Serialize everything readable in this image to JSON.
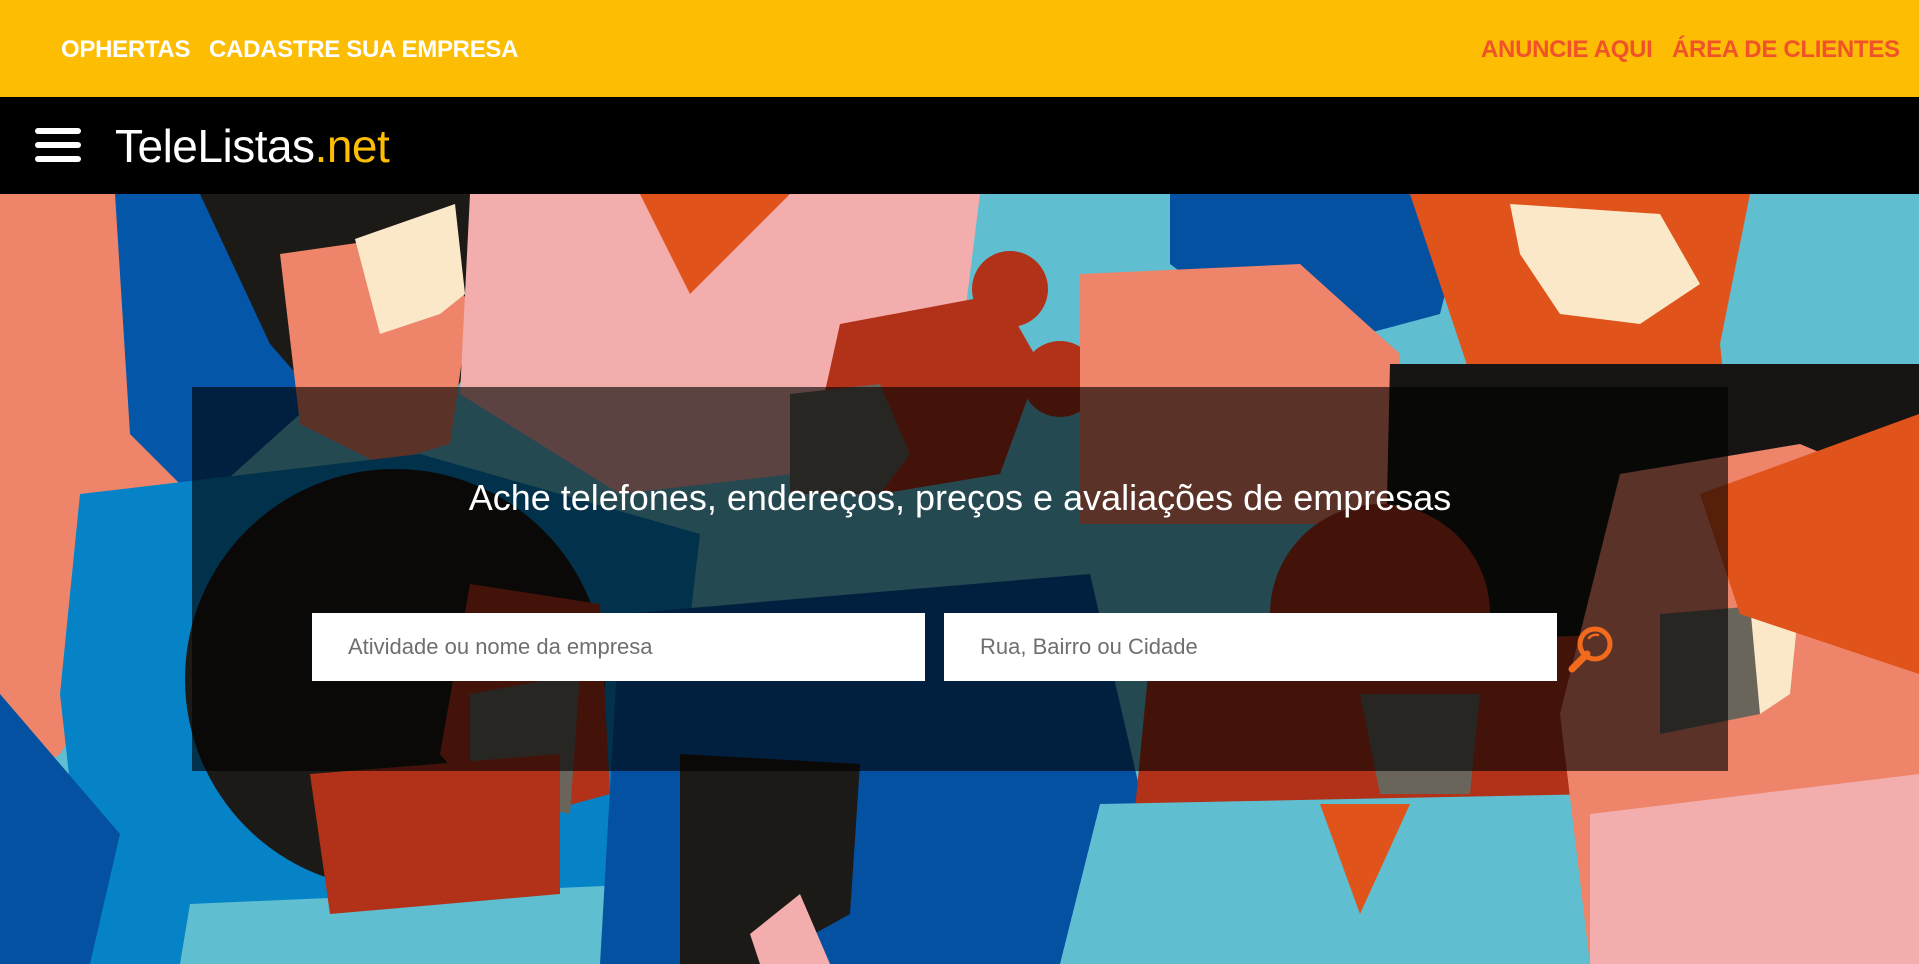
{
  "topbar": {
    "left_links": [
      {
        "label": "OPHERTAS"
      },
      {
        "label": "CADASTRE SUA EMPRESA"
      }
    ],
    "right_links": [
      {
        "label": "ANUNCIE AQUI"
      },
      {
        "label": "ÁREA DE CLIENTES"
      }
    ],
    "background": "#fdbd03",
    "left_link_color": "#ffffff",
    "right_link_color": "#f0532a"
  },
  "header": {
    "menu_icon": "hamburger-menu-icon",
    "logo_main": "TeleListas",
    "logo_tld": ".net",
    "logo_tld_color": "#fdbd03"
  },
  "hero": {
    "headline": "Ache telefones, endereços, preços e avaliações de empresas",
    "activity_placeholder": "Atividade ou nome da empresa",
    "activity_value": "",
    "location_placeholder": "Rua, Bairro ou Cidade",
    "location_value": "",
    "search_icon": "magnifier-search-icon",
    "search_icon_color": "#f26a1b"
  }
}
